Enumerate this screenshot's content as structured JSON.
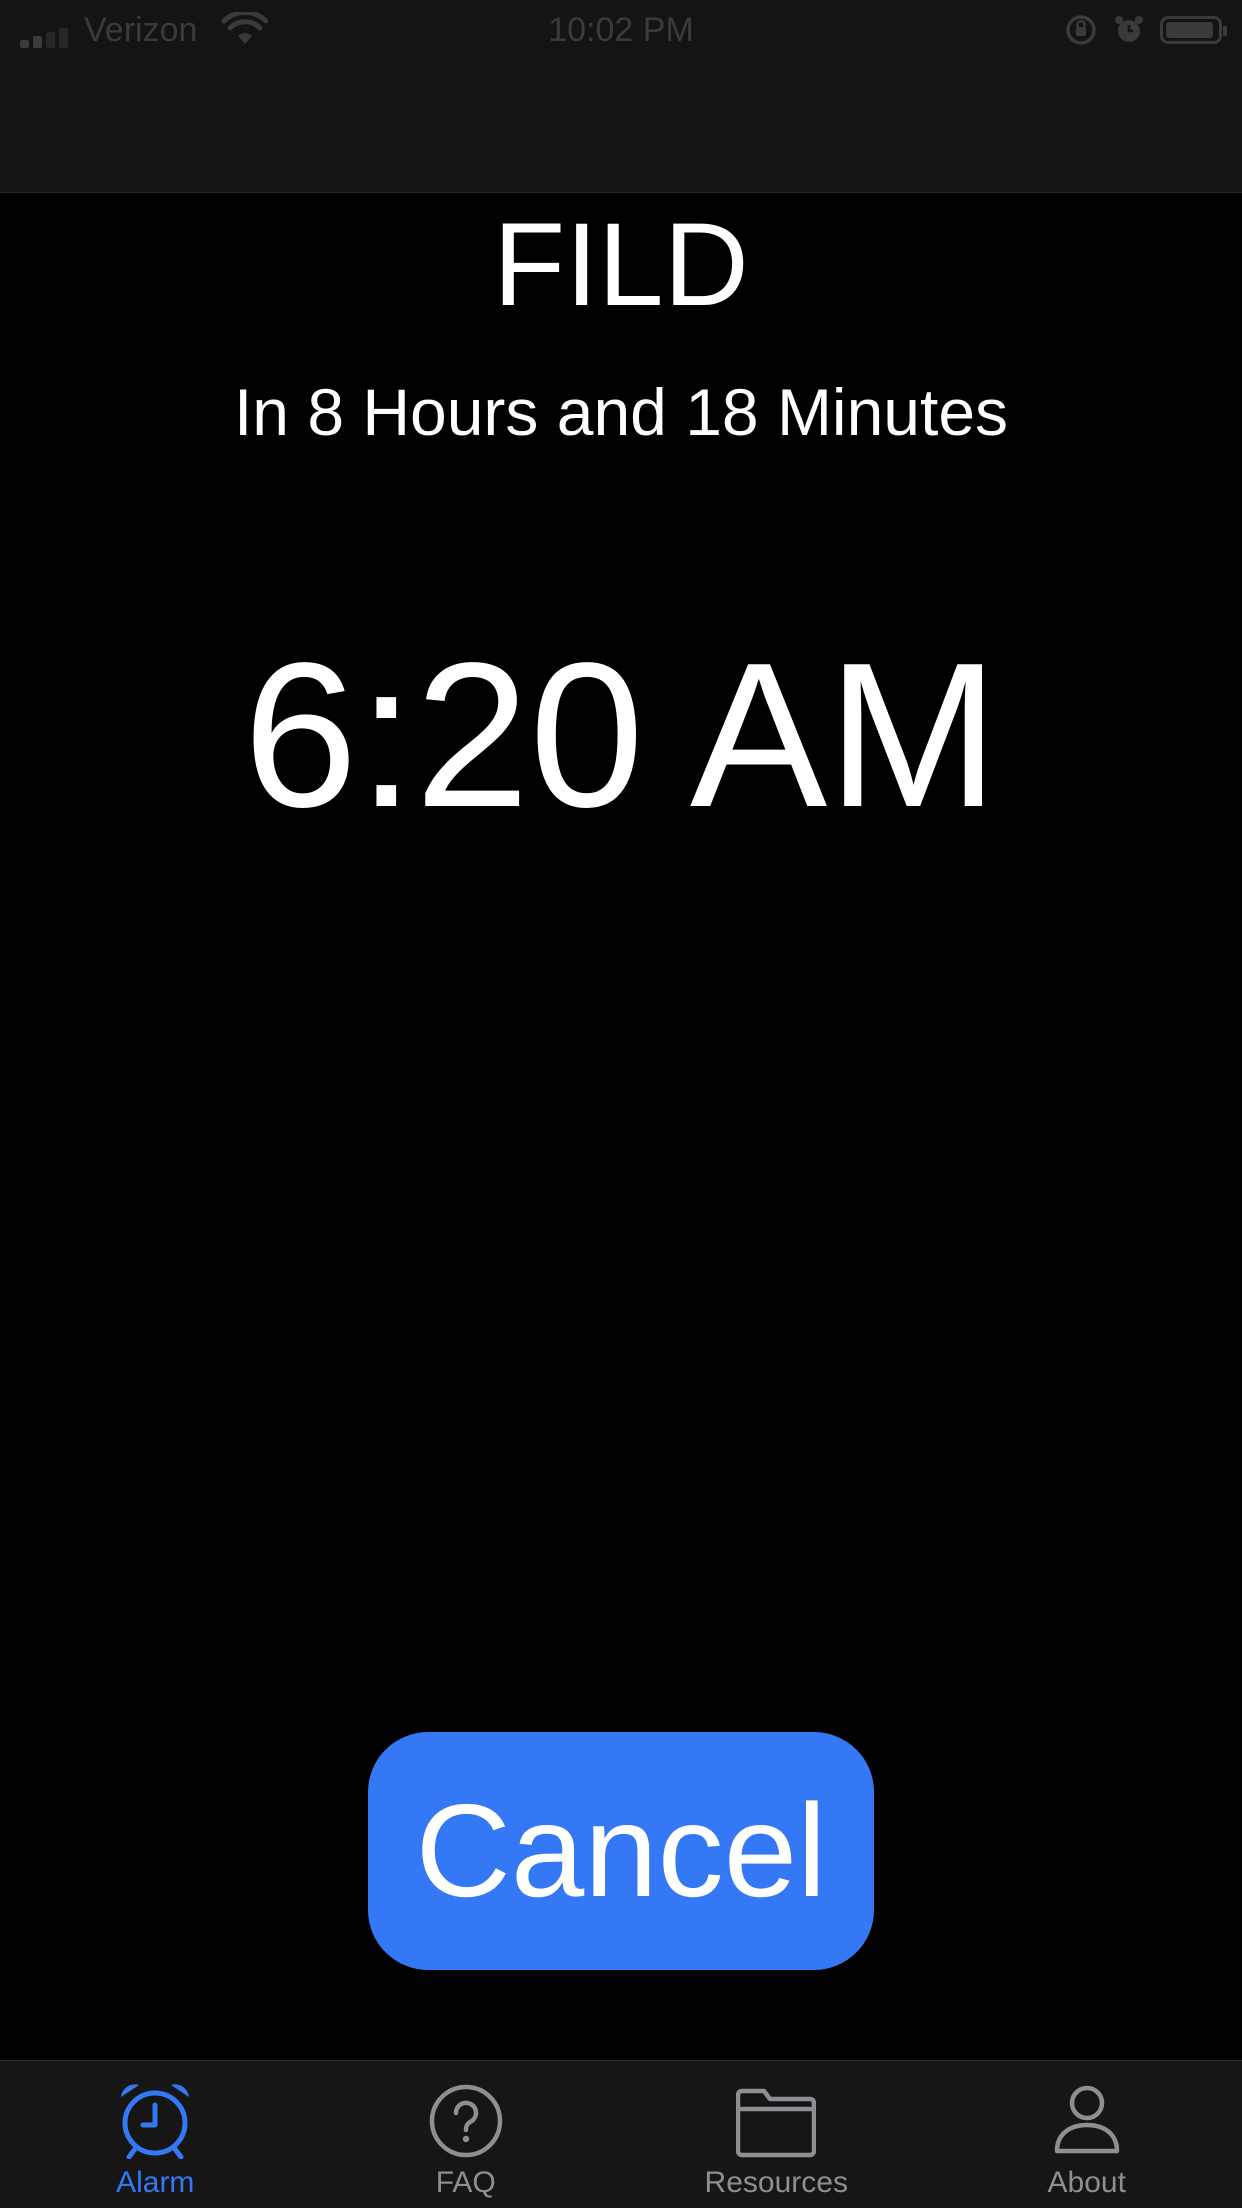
{
  "status_bar": {
    "carrier": "Verizon",
    "time": "10:02 PM"
  },
  "alarm": {
    "name": "FILD",
    "countdown": "In 8 Hours and 18 Minutes",
    "time": "6:20 AM",
    "cancel_label": "Cancel"
  },
  "tabs": [
    {
      "label": "Alarm",
      "icon": "alarm-clock-icon",
      "active": true
    },
    {
      "label": "FAQ",
      "icon": "question-circle-icon",
      "active": false
    },
    {
      "label": "Resources",
      "icon": "folder-icon",
      "active": false
    },
    {
      "label": "About",
      "icon": "person-icon",
      "active": false
    }
  ],
  "colors": {
    "accent": "#3478f6",
    "background": "#000000",
    "inactive_tab": "#8e8e93"
  }
}
